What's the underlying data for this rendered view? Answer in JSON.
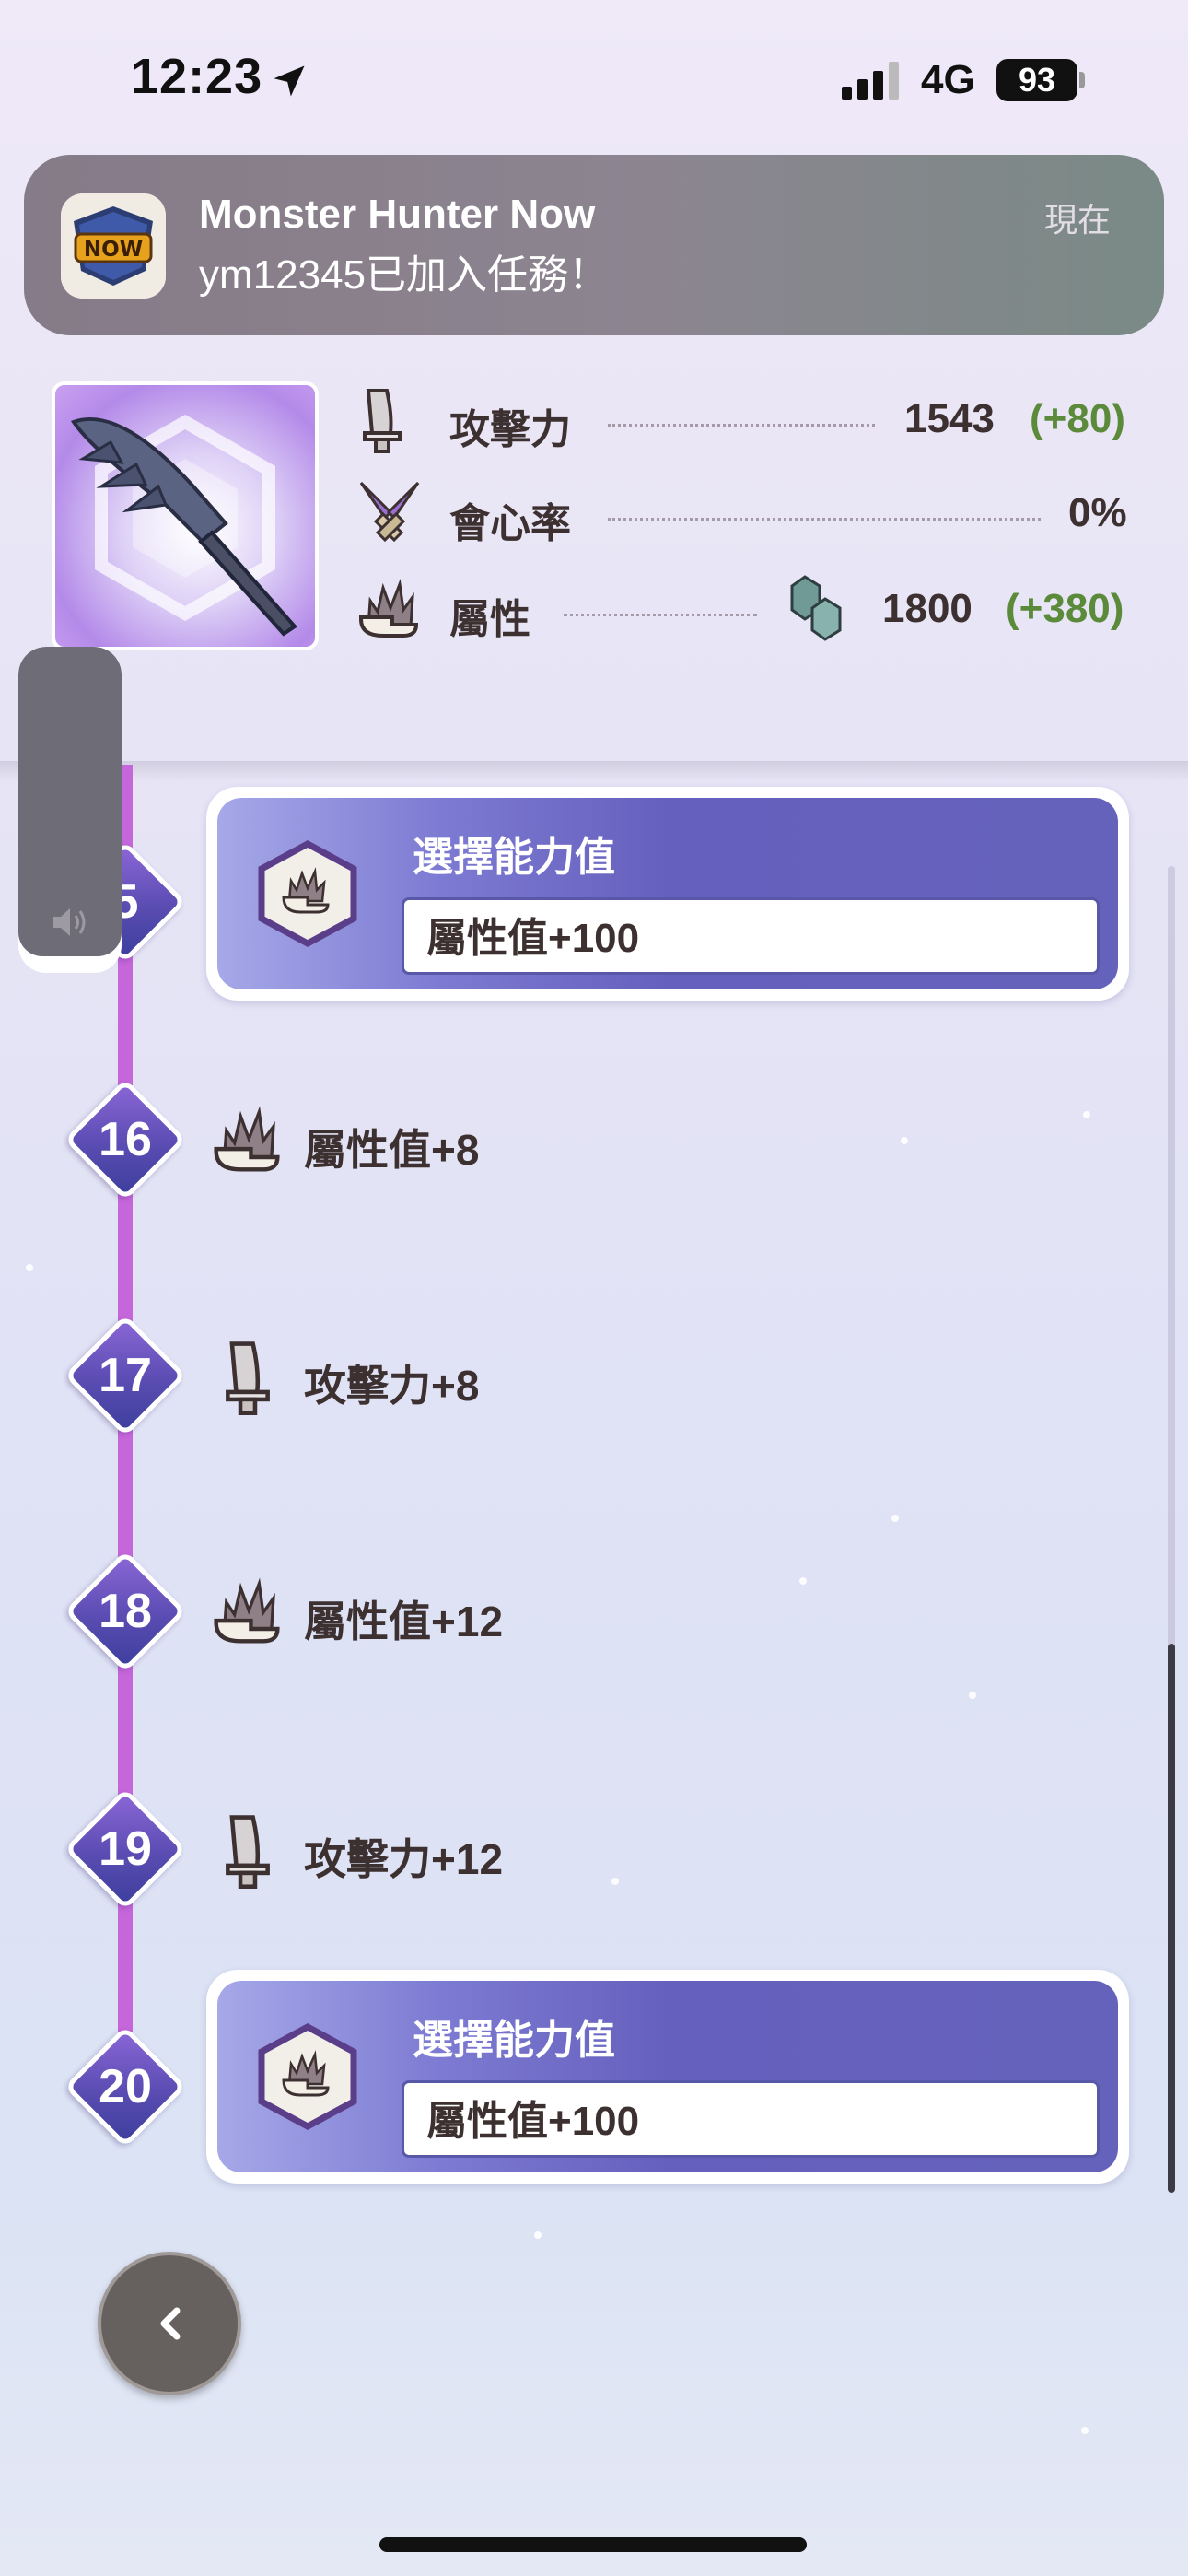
{
  "status_bar": {
    "time": "12:23",
    "network": "4G",
    "battery": "93"
  },
  "notification": {
    "app": "Monster Hunter Now",
    "message": "ym12345已加入任務！",
    "time": "現在",
    "icon_text": "NOW"
  },
  "weapon_stats": {
    "attack": {
      "label": "攻擊力",
      "value": "1543",
      "bonus": "(+80)"
    },
    "affinity": {
      "label": "會心率",
      "value": "0%"
    },
    "element": {
      "label": "屬性",
      "value": "1800",
      "bonus": "(+380)"
    }
  },
  "levels": [
    {
      "num": "15",
      "num_visible": "5",
      "type": "choice",
      "title": "選擇能力值",
      "value": "屬性值+100"
    },
    {
      "num": "16",
      "type": "reward",
      "icon": "fire-element-icon",
      "text": "屬性值+8"
    },
    {
      "num": "17",
      "type": "reward",
      "icon": "blade-attack-icon",
      "text": "攻擊力+8"
    },
    {
      "num": "18",
      "type": "reward",
      "icon": "fire-element-icon",
      "text": "屬性值+12"
    },
    {
      "num": "19",
      "type": "reward",
      "icon": "blade-attack-icon",
      "text": "攻擊力+12"
    },
    {
      "num": "20",
      "type": "choice",
      "title": "選擇能力值",
      "value": "屬性值+100"
    }
  ],
  "colors": {
    "accent": "#6562bb",
    "track": "#c566da",
    "bonus_green": "#5a8a3a"
  }
}
